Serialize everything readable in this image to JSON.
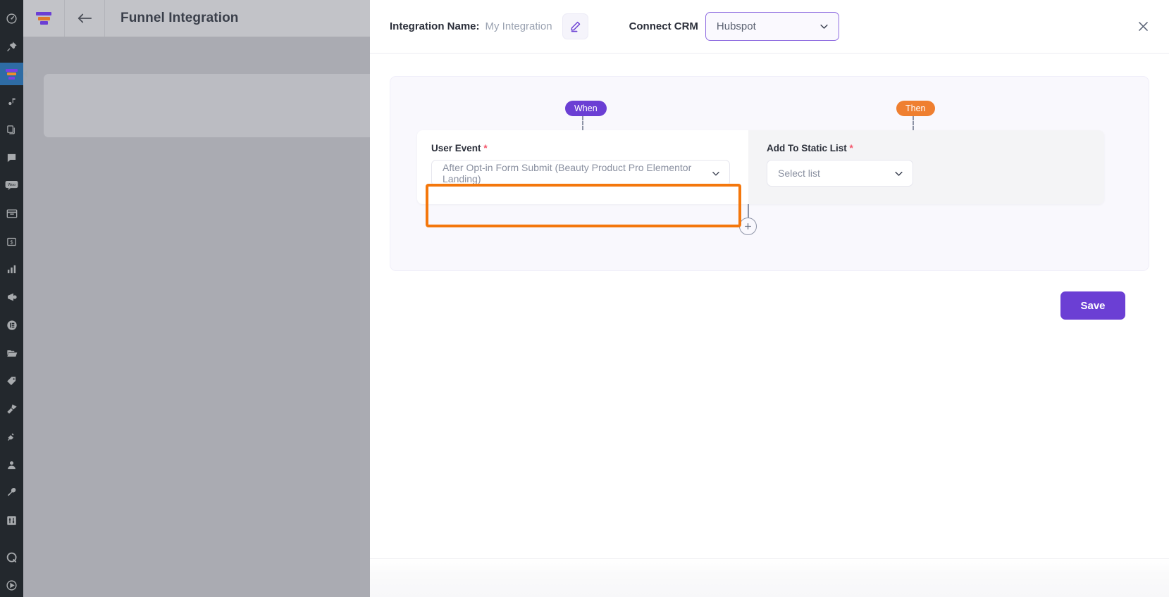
{
  "backdrop": {
    "app_title": "Funnel Integration",
    "back_icon": "arrow-left-icon",
    "logo_icon": "funnel-logo-icon",
    "sidebar_items": [
      {
        "icon": "dashboard-icon",
        "active": false
      },
      {
        "icon": "pin-icon",
        "active": false
      },
      {
        "icon": "funnel-icon",
        "active": true
      },
      {
        "icon": "media-icon",
        "active": false
      },
      {
        "icon": "pages-icon",
        "active": false
      },
      {
        "icon": "comments-icon",
        "active": false
      },
      {
        "icon": "woocommerce-icon",
        "active": false
      },
      {
        "icon": "products-icon",
        "active": false
      },
      {
        "icon": "payments-icon",
        "active": false
      },
      {
        "icon": "analytics-icon",
        "active": false
      },
      {
        "icon": "marketing-icon",
        "active": false
      },
      {
        "icon": "elementor-icon",
        "active": false
      },
      {
        "icon": "templates-icon",
        "active": false
      },
      {
        "icon": "tag-icon",
        "active": false
      },
      {
        "icon": "appearance-icon",
        "active": false
      },
      {
        "icon": "plugins-icon",
        "active": false
      },
      {
        "icon": "users-icon",
        "active": false
      },
      {
        "icon": "tools-icon",
        "active": false
      },
      {
        "icon": "settings-icon",
        "active": false
      },
      {
        "icon": "q-icon",
        "active": false
      },
      {
        "icon": "play-icon",
        "active": false
      }
    ]
  },
  "modal": {
    "close_icon": "close-icon",
    "header": {
      "integration_name_label": "Integration Name:",
      "integration_name_value": "My Integration",
      "edit_icon": "pencil-icon",
      "connect_crm_label": "Connect CRM",
      "crm_selected": "Hubspot",
      "crm_chevron_icon": "chevron-down-icon"
    },
    "flow": {
      "when_badge": "When",
      "then_badge": "Then",
      "when": {
        "field_label": "User Event",
        "required_marker": "*",
        "selected_value": "After Opt-in Form Submit (Beauty Product Pro Elementor Landing)",
        "chevron_icon": "chevron-down-icon",
        "highlighted": true
      },
      "then": {
        "field_label": "Add To Static List",
        "required_marker": "*",
        "placeholder": "Select list",
        "chevron_icon": "chevron-down-icon"
      },
      "add_step_icon": "plus-icon"
    },
    "save_label": "Save"
  },
  "colors": {
    "accent_purple": "#6b3fd4",
    "then_orange": "#ef7f30",
    "highlight_orange": "#f4770c",
    "required_red": "#f4566b",
    "card_bg": "#f9f8fd"
  }
}
